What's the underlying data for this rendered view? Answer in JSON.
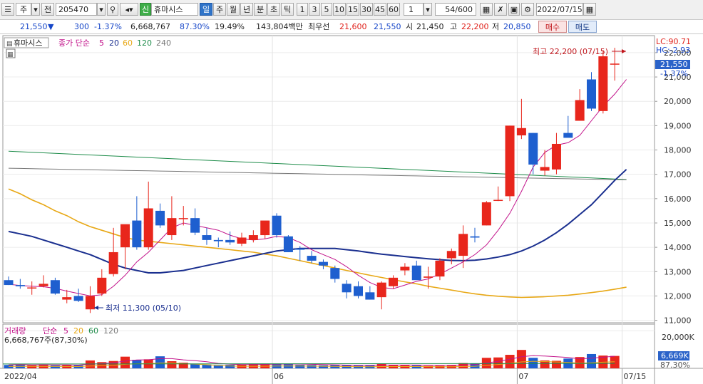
{
  "toolbar": {
    "market_label": "주",
    "prev_label": "전",
    "code": "205470",
    "new_badge": "신",
    "stock_name": "휴마시스",
    "periods": [
      "일",
      "주",
      "월",
      "년",
      "분",
      "초",
      "틱"
    ],
    "selected_period": "일",
    "intervals": [
      "1",
      "3",
      "5",
      "10",
      "15",
      "30",
      "45",
      "60"
    ],
    "interval_value": "1",
    "count_label": "54/600",
    "date": "2022/07/15"
  },
  "infobar": {
    "price": "21,550",
    "direction": "▼",
    "change": "300",
    "change_pct": "-1.37%",
    "volume": "6,668,767",
    "vol_ratio": "87.30%",
    "turnover": "19.49%",
    "amount": "143,804백만",
    "best_ask_label": "최우선",
    "best_ask": "21,600",
    "best_bid": "21,550",
    "open_label": "시",
    "open": "21,450",
    "high_label": "고",
    "high": "22,200",
    "low_label": "저",
    "low": "20,850",
    "buy_label": "매수",
    "sell_label": "매도"
  },
  "price_legend": {
    "name": "휴마시스",
    "label": "종가 단순",
    "periods": [
      "5",
      "20",
      "60",
      "120",
      "240"
    ]
  },
  "volume_legend": {
    "label": "거래량",
    "sub": "단순",
    "periods": [
      "5",
      "20",
      "60",
      "120"
    ],
    "value_text": "6,668,767주(87,30%)"
  },
  "right_axis": {
    "lc": "LC:90.71",
    "hc": "HC:-2.93",
    "price_tag": "21,550",
    "pct_tag": "-1.37%",
    "vol_tag": "6,669K",
    "vol_pct_tag": "87.30%",
    "vol_tick": "20,000K",
    "vol_tick_value": 20000
  },
  "annotations": {
    "high": "최고 22,200 (07/15)",
    "low": "최저 11,300 (05/10)"
  },
  "colors": {
    "up": "#e8261c",
    "down": "#1e5fcf",
    "ma5": "#c2128a",
    "ma20": "#1a2f8f",
    "ma60": "#e8a816",
    "ma120": "#1e8c4a",
    "ma240": "#777777"
  },
  "chart_data": {
    "type": "candlestick",
    "x_labels": [
      {
        "index": 0,
        "label": "2022/04"
      },
      {
        "index": 23,
        "label": "06"
      },
      {
        "index": 44,
        "label": "07"
      },
      {
        "index": 53,
        "label": "07/15"
      }
    ],
    "ylim": [
      10900,
      22700
    ],
    "yticks": [
      11000,
      12000,
      13000,
      14000,
      15000,
      16000,
      17000,
      18000,
      19000,
      20000,
      21000,
      22000
    ],
    "candles": [
      {
        "o": 12650,
        "h": 12800,
        "l": 12450,
        "c": 12450
      },
      {
        "o": 12450,
        "h": 12700,
        "l": 12300,
        "c": 12400
      },
      {
        "o": 12350,
        "h": 12600,
        "l": 12050,
        "c": 12350
      },
      {
        "o": 12400,
        "h": 12850,
        "l": 12350,
        "c": 12500
      },
      {
        "o": 12650,
        "h": 12750,
        "l": 12050,
        "c": 12100
      },
      {
        "o": 11850,
        "h": 12250,
        "l": 11700,
        "c": 11950
      },
      {
        "o": 12000,
        "h": 12300,
        "l": 11750,
        "c": 11800
      },
      {
        "o": 11450,
        "h": 12400,
        "l": 11300,
        "c": 12000
      },
      {
        "o": 12100,
        "h": 13100,
        "l": 12000,
        "c": 12750
      },
      {
        "o": 12900,
        "h": 14800,
        "l": 12800,
        "c": 13800
      },
      {
        "o": 14000,
        "h": 14900,
        "l": 13100,
        "c": 14950
      },
      {
        "o": 15100,
        "h": 16100,
        "l": 13900,
        "c": 14000
      },
      {
        "o": 14000,
        "h": 16700,
        "l": 13900,
        "c": 15600
      },
      {
        "o": 15500,
        "h": 15800,
        "l": 14800,
        "c": 14900
      },
      {
        "o": 14500,
        "h": 16100,
        "l": 14300,
        "c": 15200
      },
      {
        "o": 15200,
        "h": 15700,
        "l": 14900,
        "c": 15200
      },
      {
        "o": 15200,
        "h": 15600,
        "l": 14500,
        "c": 14600
      },
      {
        "o": 14500,
        "h": 14800,
        "l": 14100,
        "c": 14300
      },
      {
        "o": 14300,
        "h": 14400,
        "l": 14000,
        "c": 14250
      },
      {
        "o": 14300,
        "h": 14650,
        "l": 14100,
        "c": 14200
      },
      {
        "o": 14150,
        "h": 14600,
        "l": 14050,
        "c": 14400
      },
      {
        "o": 14300,
        "h": 14700,
        "l": 14200,
        "c": 14500
      },
      {
        "o": 14500,
        "h": 14950,
        "l": 14350,
        "c": 15100
      },
      {
        "o": 15300,
        "h": 15400,
        "l": 14400,
        "c": 14500
      },
      {
        "o": 14450,
        "h": 14500,
        "l": 13800,
        "c": 13800
      },
      {
        "o": 13950,
        "h": 14050,
        "l": 13450,
        "c": 13900
      },
      {
        "o": 13650,
        "h": 13850,
        "l": 13350,
        "c": 13450
      },
      {
        "o": 13400,
        "h": 13500,
        "l": 13100,
        "c": 13250
      },
      {
        "o": 13150,
        "h": 13250,
        "l": 12550,
        "c": 12700
      },
      {
        "o": 12500,
        "h": 12650,
        "l": 11900,
        "c": 12150
      },
      {
        "o": 12400,
        "h": 12600,
        "l": 11900,
        "c": 12000
      },
      {
        "o": 12150,
        "h": 12400,
        "l": 11850,
        "c": 11850
      },
      {
        "o": 11950,
        "h": 12600,
        "l": 11450,
        "c": 12550
      },
      {
        "o": 12400,
        "h": 12850,
        "l": 12300,
        "c": 12750
      },
      {
        "o": 13050,
        "h": 13350,
        "l": 12850,
        "c": 13200
      },
      {
        "o": 13250,
        "h": 13450,
        "l": 12700,
        "c": 12650
      },
      {
        "o": 12750,
        "h": 13200,
        "l": 12300,
        "c": 12800
      },
      {
        "o": 12800,
        "h": 13550,
        "l": 12650,
        "c": 13450
      },
      {
        "o": 13550,
        "h": 13950,
        "l": 13300,
        "c": 13850
      },
      {
        "o": 13650,
        "h": 14900,
        "l": 13150,
        "c": 14550
      },
      {
        "o": 14450,
        "h": 14800,
        "l": 14200,
        "c": 14400
      },
      {
        "o": 14900,
        "h": 15900,
        "l": 14900,
        "c": 15850
      },
      {
        "o": 15950,
        "h": 16500,
        "l": 15900,
        "c": 15950
      },
      {
        "o": 16100,
        "h": 19000,
        "l": 15900,
        "c": 19000
      },
      {
        "o": 18600,
        "h": 20100,
        "l": 18450,
        "c": 18900
      },
      {
        "o": 18700,
        "h": 18700,
        "l": 17000,
        "c": 17400
      },
      {
        "o": 17150,
        "h": 18000,
        "l": 16950,
        "c": 17300
      },
      {
        "o": 17200,
        "h": 18700,
        "l": 17000,
        "c": 18250
      },
      {
        "o": 18700,
        "h": 19400,
        "l": 18550,
        "c": 18500
      },
      {
        "o": 19200,
        "h": 20500,
        "l": 19200,
        "c": 20050
      },
      {
        "o": 20900,
        "h": 21200,
        "l": 19600,
        "c": 19700
      },
      {
        "o": 19600,
        "h": 22100,
        "l": 19500,
        "c": 21850
      },
      {
        "o": 21550,
        "h": 22200,
        "l": 20850,
        "c": 21550
      }
    ],
    "volume": [
      180,
      210,
      160,
      200,
      150,
      190,
      160,
      420,
      330,
      390,
      620,
      450,
      480,
      640,
      380,
      300,
      240,
      200,
      180,
      190,
      200,
      240,
      230,
      250,
      220,
      190,
      180,
      160,
      170,
      160,
      150,
      160,
      230,
      170,
      160,
      150,
      130,
      150,
      180,
      280,
      260,
      560,
      580,
      720,
      980,
      560,
      420,
      400,
      520,
      600,
      760,
      680,
      660
    ],
    "volume_ylim": [
      0,
      22000
    ],
    "ma": {
      "ma5": [
        12480,
        12430,
        12400,
        12380,
        12310,
        12200,
        12100,
        12000,
        12050,
        12400,
        12850,
        13400,
        13800,
        14300,
        14800,
        15000,
        14900,
        14800,
        14700,
        14500,
        14350,
        14300,
        14350,
        14450,
        14400,
        14200,
        13900,
        13700,
        13500,
        13200,
        12850,
        12550,
        12350,
        12300,
        12450,
        12600,
        12700,
        12900,
        13150,
        13400,
        13700,
        14100,
        14700,
        15400,
        16300,
        17300,
        17900,
        18200,
        18300,
        18600,
        19200,
        19800,
        20300,
        20900
      ],
      "ma20": [
        14650,
        14550,
        14450,
        14300,
        14150,
        14000,
        13850,
        13700,
        13500,
        13300,
        13150,
        13050,
        12950,
        12950,
        13000,
        13050,
        13150,
        13250,
        13350,
        13450,
        13550,
        13650,
        13750,
        13850,
        13900,
        13950,
        13950,
        13950,
        13950,
        13900,
        13850,
        13780,
        13720,
        13670,
        13620,
        13570,
        13530,
        13490,
        13460,
        13450,
        13470,
        13520,
        13600,
        13700,
        13850,
        14050,
        14300,
        14600,
        14950,
        15350,
        15750,
        16250,
        16750,
        17200
      ],
      "ma60": [
        16400,
        16200,
        15950,
        15750,
        15500,
        15300,
        15050,
        14850,
        14700,
        14550,
        14400,
        14300,
        14250,
        14200,
        14150,
        14100,
        14050,
        14000,
        13950,
        13900,
        13850,
        13800,
        13720,
        13650,
        13550,
        13450,
        13350,
        13250,
        13150,
        13050,
        12950,
        12850,
        12760,
        12670,
        12580,
        12500,
        12400,
        12320,
        12240,
        12160,
        12090,
        12030,
        11990,
        11960,
        11940,
        11950,
        11970,
        12000,
        12030,
        12080,
        12140,
        12200,
        12280,
        12360
      ]
    }
  }
}
